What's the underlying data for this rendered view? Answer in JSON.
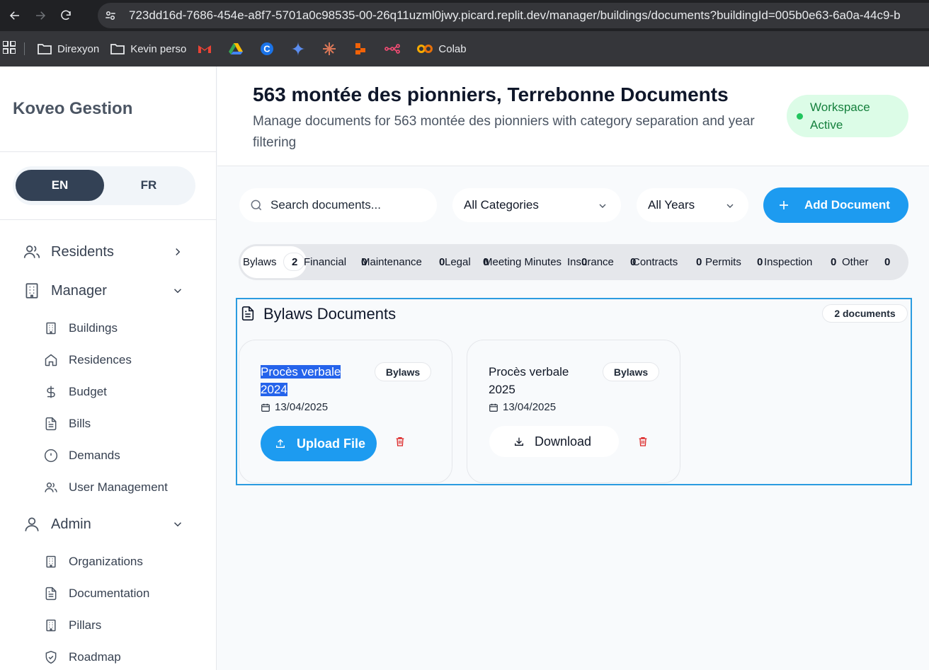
{
  "browser": {
    "url": "723dd16d-7686-454e-a8f7-5701a0c98535-00-26q11uzml0jwy.picard.replit.dev/manager/buildings/documents?buildingId=005b0e63-6a0a-44c9-b",
    "bookmarks": [
      "Direxyon",
      "Kevin perso",
      "Colab"
    ]
  },
  "sidebar": {
    "brand": "Koveo Gestion",
    "lang": {
      "en": "EN",
      "fr": "FR"
    },
    "sections": {
      "residents": "Residents",
      "manager": "Manager",
      "admin": "Admin"
    },
    "manager_items": [
      "Buildings",
      "Residences",
      "Budget",
      "Bills",
      "Demands",
      "User Management"
    ],
    "admin_items": [
      "Organizations",
      "Documentation",
      "Pillars",
      "Roadmap"
    ]
  },
  "header": {
    "title": "563 montée des pionniers, Terrebonne Documents",
    "subtitle": "Manage documents for 563 montée des pionniers with category separation and year filtering",
    "workspace_badge": "Workspace Active"
  },
  "filters": {
    "search_placeholder": "Search documents...",
    "category": "All Categories",
    "year": "All Years",
    "add_button": "Add Document"
  },
  "tabs": [
    {
      "label": "Bylaws",
      "count": "2"
    },
    {
      "label": "Financial",
      "count": "0"
    },
    {
      "label": "Maintenance",
      "count": "0"
    },
    {
      "label": "Legal",
      "count": "0"
    },
    {
      "label": "Meeting Minutes",
      "count": "0"
    },
    {
      "label": "Insurance",
      "count": "0"
    },
    {
      "label": "Contracts",
      "count": "0"
    },
    {
      "label": "Permits",
      "count": "0"
    },
    {
      "label": "Inspection",
      "count": "0"
    },
    {
      "label": "Other",
      "count": "0"
    }
  ],
  "documents": {
    "heading": "Bylaws Documents",
    "count_label": "2 documents",
    "cards": [
      {
        "title_line1": "Procès verbale",
        "title_line2": "2024",
        "category": "Bylaws",
        "date": "13/04/2025",
        "action": "Upload File"
      },
      {
        "title_line1": "Procès verbale",
        "title_line2": "2025",
        "category": "Bylaws",
        "date": "13/04/2025",
        "action": "Download"
      }
    ]
  },
  "colors": {
    "accent": "#1d9bf0",
    "sidebar_active": "#334155",
    "badge_green": "#dcfce7",
    "danger": "#dc2626"
  }
}
